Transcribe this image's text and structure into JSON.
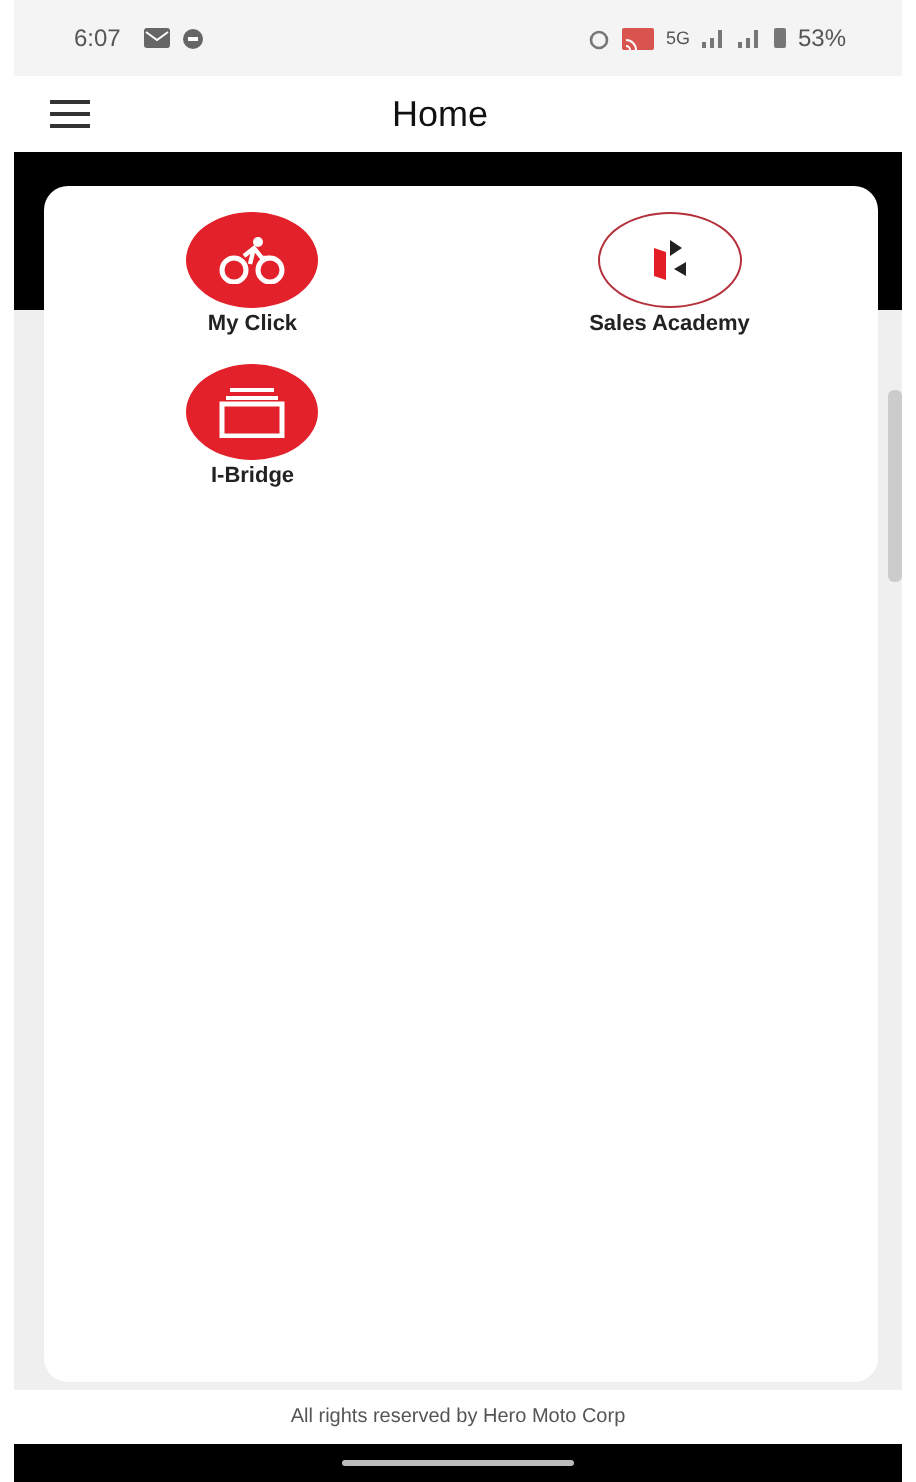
{
  "status_bar": {
    "time": "6:07",
    "network": "5G",
    "battery": "53%"
  },
  "app_bar": {
    "title": "Home"
  },
  "apps": [
    {
      "label": "My Click",
      "kind": "bike"
    },
    {
      "label": "Sales Academy",
      "kind": "logo"
    },
    {
      "label": "I-Bridge",
      "kind": "stack"
    }
  ],
  "footer": {
    "text": "All rights reserved by Hero Moto Corp"
  }
}
